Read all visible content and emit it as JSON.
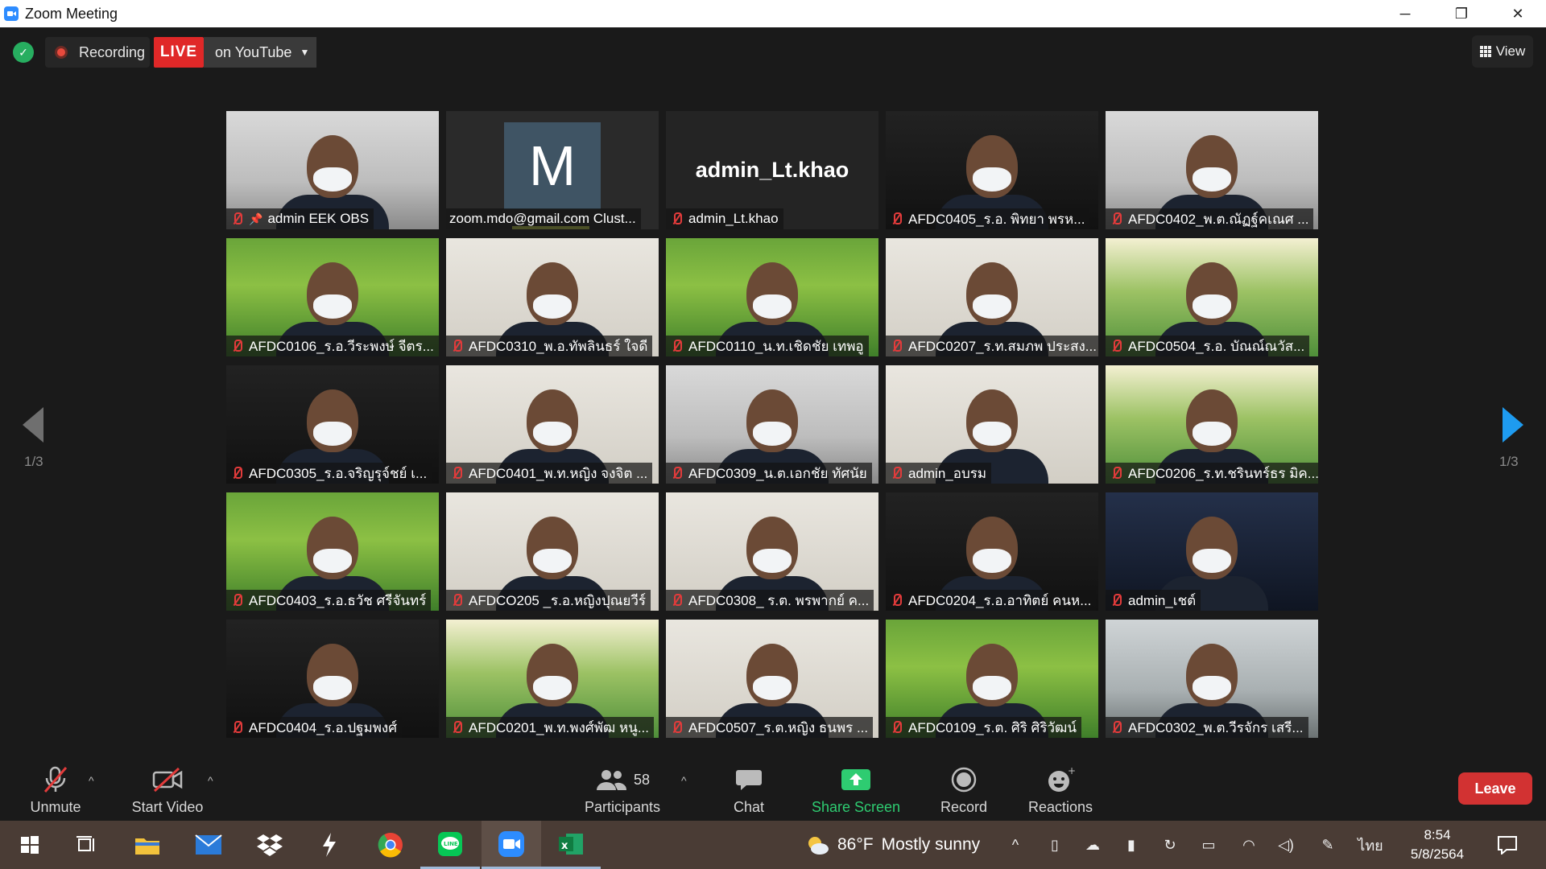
{
  "window": {
    "title": "Zoom Meeting"
  },
  "topbar": {
    "recording_label": "Recording",
    "live_label": "LIVE",
    "stream_target": "on YouTube",
    "view_label": "View"
  },
  "pager": {
    "left_page": "1/3",
    "right_page": "1/3"
  },
  "tiles": [
    {
      "name": "admin EEK OBS",
      "scene": "office",
      "muted": true,
      "pinned": true,
      "active": true
    },
    {
      "name": "zoom.mdo@gmail.com Clust...",
      "scene": "avatar",
      "avatar_letter": "M",
      "muted": false
    },
    {
      "name": "admin_Lt.khao",
      "scene": "name",
      "display": "admin_Lt.khao",
      "muted": true
    },
    {
      "name": "AFDC0405_ร.อ. พิทยา  พรห...",
      "scene": "dark",
      "muted": true
    },
    {
      "name": "AFDC0402_พ.ต.ณัฏฐ์คเณศ ...",
      "scene": "office",
      "muted": true
    },
    {
      "name": "AFDC0106_ร.อ.วีระพงษ์ จีตร...",
      "scene": "field",
      "muted": true
    },
    {
      "name": "AFDC0310_พ.อ.ทัพลินธร์ ใจดี",
      "scene": "wall",
      "muted": true
    },
    {
      "name": "AFDC0110_น.ท.เชิดชัย  เทพอู",
      "scene": "field",
      "muted": true
    },
    {
      "name": "AFDC0207_ร.ท.สมภพ ประสง...",
      "scene": "wall",
      "muted": true
    },
    {
      "name": "AFDC0504_ร.อ. บัณณ์ณวัส...",
      "scene": "village",
      "muted": true
    },
    {
      "name": "AFDC0305_ร.อ.จริญรุจ์ชย์ เ...",
      "scene": "dark",
      "muted": true
    },
    {
      "name": "AFDC0401_พ.ท.หญิง จงจิต ...",
      "scene": "wall",
      "muted": true
    },
    {
      "name": "AFDC0309_น.ต.เอกชัย ทัศนัย",
      "scene": "office",
      "muted": true
    },
    {
      "name": "admin_อบรม",
      "scene": "wall",
      "muted": true
    },
    {
      "name": "AFDC0206_ร.ท.ชรินทร์ธร มิค...",
      "scene": "village",
      "muted": true
    },
    {
      "name": "AFDC0403_ร.อ.ธวัช  ศรีจันทร์",
      "scene": "field",
      "muted": true
    },
    {
      "name": "AFDCO205 _ร.อ.หญิงปุณยวีร์",
      "scene": "wall",
      "muted": true
    },
    {
      "name": "AFDC0308_ ร.ต. พรพากย์ ค...",
      "scene": "wall",
      "muted": true
    },
    {
      "name": "AFDC0204_ร.อ.อาทิตย์ คนห...",
      "scene": "dark",
      "muted": true
    },
    {
      "name": "admin_เชต์",
      "scene": "city",
      "muted": true
    },
    {
      "name": "AFDC0404_ร.อ.ปฐมพงศ์",
      "scene": "dark",
      "muted": true
    },
    {
      "name": "AFDC0201_พ.ท.พงศ์พัฒ หนู...",
      "scene": "village",
      "muted": true
    },
    {
      "name": "AFDC0507_ร.ต.หญิง ธนพร ...",
      "scene": "wall",
      "muted": true
    },
    {
      "name": "AFDC0109_ร.ต. ศิริ  ศิริวัฒน์",
      "scene": "field",
      "muted": true
    },
    {
      "name": "AFDC0302_พ.ต.วีรจักร เสรี...",
      "scene": "fog",
      "muted": true
    }
  ],
  "toolbar": {
    "unmute": "Unmute",
    "start_video": "Start Video",
    "participants": "Participants",
    "participant_count": "58",
    "chat": "Chat",
    "share_screen": "Share Screen",
    "record": "Record",
    "reactions": "Reactions",
    "leave": "Leave"
  },
  "taskbar": {
    "temperature": "86°F",
    "weather": "Mostly sunny",
    "language": "ไทย",
    "time": "8:54",
    "date": "5/8/2564"
  },
  "colors": {
    "live_red": "#e02828",
    "share_green": "#2ecc71",
    "active_speaker": "#d7e957",
    "leave_red": "#d23232"
  }
}
